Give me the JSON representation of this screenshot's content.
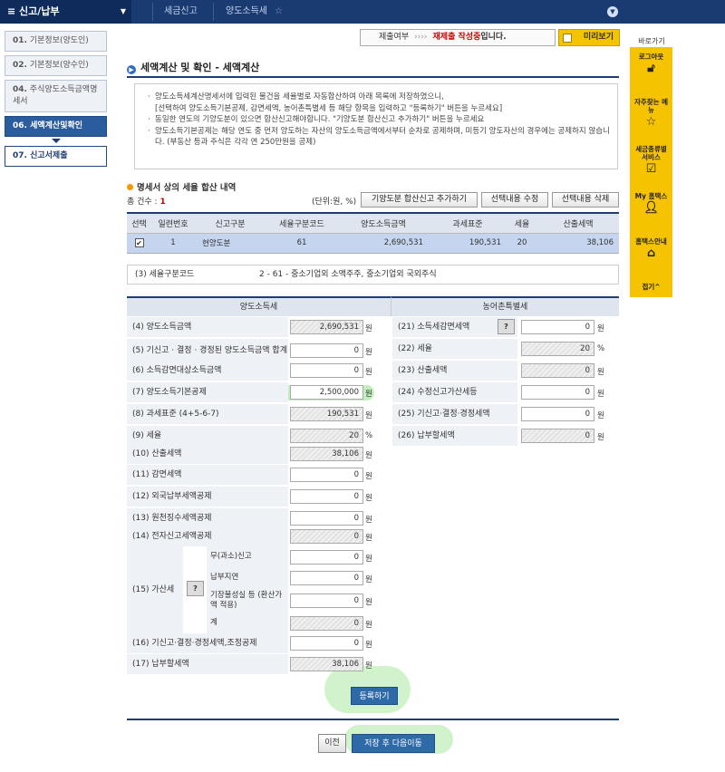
{
  "topbar": {
    "menu": "신고/납부",
    "crumb1": "세금신고",
    "crumb2": "양도소득세"
  },
  "sidebar": [
    {
      "num": "01.",
      "label": "기본정보(양도인)"
    },
    {
      "num": "02.",
      "label": "기본정보(양수인)"
    },
    {
      "num": "04.",
      "label": "주식양도소득금액명세서"
    },
    {
      "num": "06.",
      "label": "세액계산및확인"
    },
    {
      "num": "07.",
      "label": "신고서제출"
    }
  ],
  "status": {
    "label": "제출여부",
    "arrows": "››››",
    "red": "재제출 작성중",
    "suffix": "입니다."
  },
  "preview": "미리보기",
  "title": "세액계산 및 확인 - 세액계산",
  "notice": [
    "양도소득세계산명세서에 입력된 물건을 세율별로 자동합산하여 아래 목록에 저장하였으니,",
    "[선택하여 양도소득기본공제, 감면세액, 농어촌특별세 등 해당 항목을 입력하고 \"등록하기\" 버튼을 누르세요]",
    "동일한 연도의 기양도분이 있으면 합산신고해야합니다. \"기양도분 합산신고 추가하기\" 버튼을 누르세요",
    "양도소득기본공제는 해당 연도 중 먼저 양도하는 자산의 양도소득금액에서부터 순차로 공제하며, 미등기 양도자산의 경우에는 공제하지 않습니다. (부동산 등과 주식은 각각 연 250만원을 공제)"
  ],
  "list": {
    "heading": "명세서 상의 세율 합산 내역",
    "count_label": "총 건수 :",
    "count": "1",
    "unit": "(단위:원, %)",
    "buttons": [
      "기양도분 합산신고 추가하기",
      "선택내용 수정",
      "선택내용 삭제"
    ],
    "columns": [
      "선택",
      "일련번호",
      "신고구분",
      "세율구분코드",
      "양도소득금액",
      "과세표준",
      "세율",
      "산출세액"
    ],
    "rows": [
      {
        "seq": "1",
        "type": "현양도분",
        "code": "61",
        "gain": "2,690,531",
        "base": "190,531",
        "rate": "20",
        "tax": "38,106"
      }
    ]
  },
  "code": {
    "label": "(3) 세율구분코드",
    "value": "2 - 61 - 중소기업외 소액주주, 중소기업외 국외주식"
  },
  "left": {
    "header": "양도소득세",
    "rows": [
      {
        "label": "(4) 양도소득금액",
        "value": "2,690,531",
        "unit": "원",
        "ro": true
      },
      {
        "label": "(5) 기신고 · 결정 · 경정된 양도소득금액 합계",
        "value": "0",
        "unit": "원",
        "ro": false
      },
      {
        "label": "(6) 소득감면대상소득금액",
        "value": "0",
        "unit": "원",
        "ro": false
      },
      {
        "label": "(7) 양도소득기본공제",
        "value": "2,500,000",
        "unit": "원",
        "ro": false
      },
      {
        "label": "(8) 과세표준 (4+5-6-7)",
        "value": "190,531",
        "unit": "원",
        "ro": true
      },
      {
        "label": "(9) 세율",
        "value": "20",
        "unit": "%",
        "ro": true
      },
      {
        "label": "(10) 산출세액",
        "value": "38,106",
        "unit": "원",
        "ro": true
      },
      {
        "label": "(11) 감면세액",
        "value": "0",
        "unit": "원",
        "ro": false
      },
      {
        "label": "(12) 외국납부세액공제",
        "value": "0",
        "unit": "원",
        "ro": false
      },
      {
        "label": "(13) 원천징수세액공제",
        "value": "0",
        "unit": "원",
        "ro": false
      },
      {
        "label": "(14) 전자신고세액공제",
        "value": "0",
        "unit": "원",
        "ro": true
      }
    ],
    "penalty": {
      "label": "(15) 가산세",
      "help": "?",
      "items": [
        {
          "label": "무(과소)신고",
          "value": "0",
          "unit": "원",
          "ro": false
        },
        {
          "label": "납부지연",
          "value": "0",
          "unit": "원",
          "ro": false
        },
        {
          "label": "기장불성실 등 (환산가액 적용)",
          "value": "0",
          "unit": "원",
          "ro": false
        },
        {
          "label": "계",
          "value": "0",
          "unit": "원",
          "ro": true
        }
      ]
    },
    "tail": [
      {
        "label": "(16) 기신고·결정·경정세액,조정공제",
        "value": "0",
        "unit": "원",
        "ro": false
      },
      {
        "label": "(17) 납부할세액",
        "value": "38,106",
        "unit": "원",
        "ro": true
      }
    ]
  },
  "right": {
    "header": "농어촌특별세",
    "rows": [
      {
        "label": "(21) 소득세감면세액",
        "value": "0",
        "unit": "원",
        "ro": false,
        "help": "?"
      },
      {
        "label": "(22) 세율",
        "value": "20",
        "unit": "%",
        "ro": true
      },
      {
        "label": "(23) 산출세액",
        "value": "0",
        "unit": "원",
        "ro": true
      },
      {
        "label": "(24) 수정신고가산세등",
        "value": "0",
        "unit": "원",
        "ro": false
      },
      {
        "label": "(25) 기신고·결정·경정세액",
        "value": "0",
        "unit": "원",
        "ro": false
      },
      {
        "label": "(26) 납부할세액",
        "value": "0",
        "unit": "원",
        "ro": true
      }
    ]
  },
  "register": "등록하기",
  "prev": "이전",
  "save_next": "저장 후 다음이동",
  "quick": {
    "title": "바로가기",
    "items": [
      {
        "label": "로그아웃",
        "icon": "lock-icon"
      },
      {
        "label": "자주찾는 메뉴",
        "icon": "star-icon"
      },
      {
        "label": "세금종류별 서비스",
        "icon": "checkbox-icon"
      },
      {
        "label": "My 홈택스",
        "icon": "person-icon"
      },
      {
        "label": "홈택스안내",
        "icon": "home-icon"
      },
      {
        "label": "접기^",
        "icon": ""
      }
    ]
  }
}
